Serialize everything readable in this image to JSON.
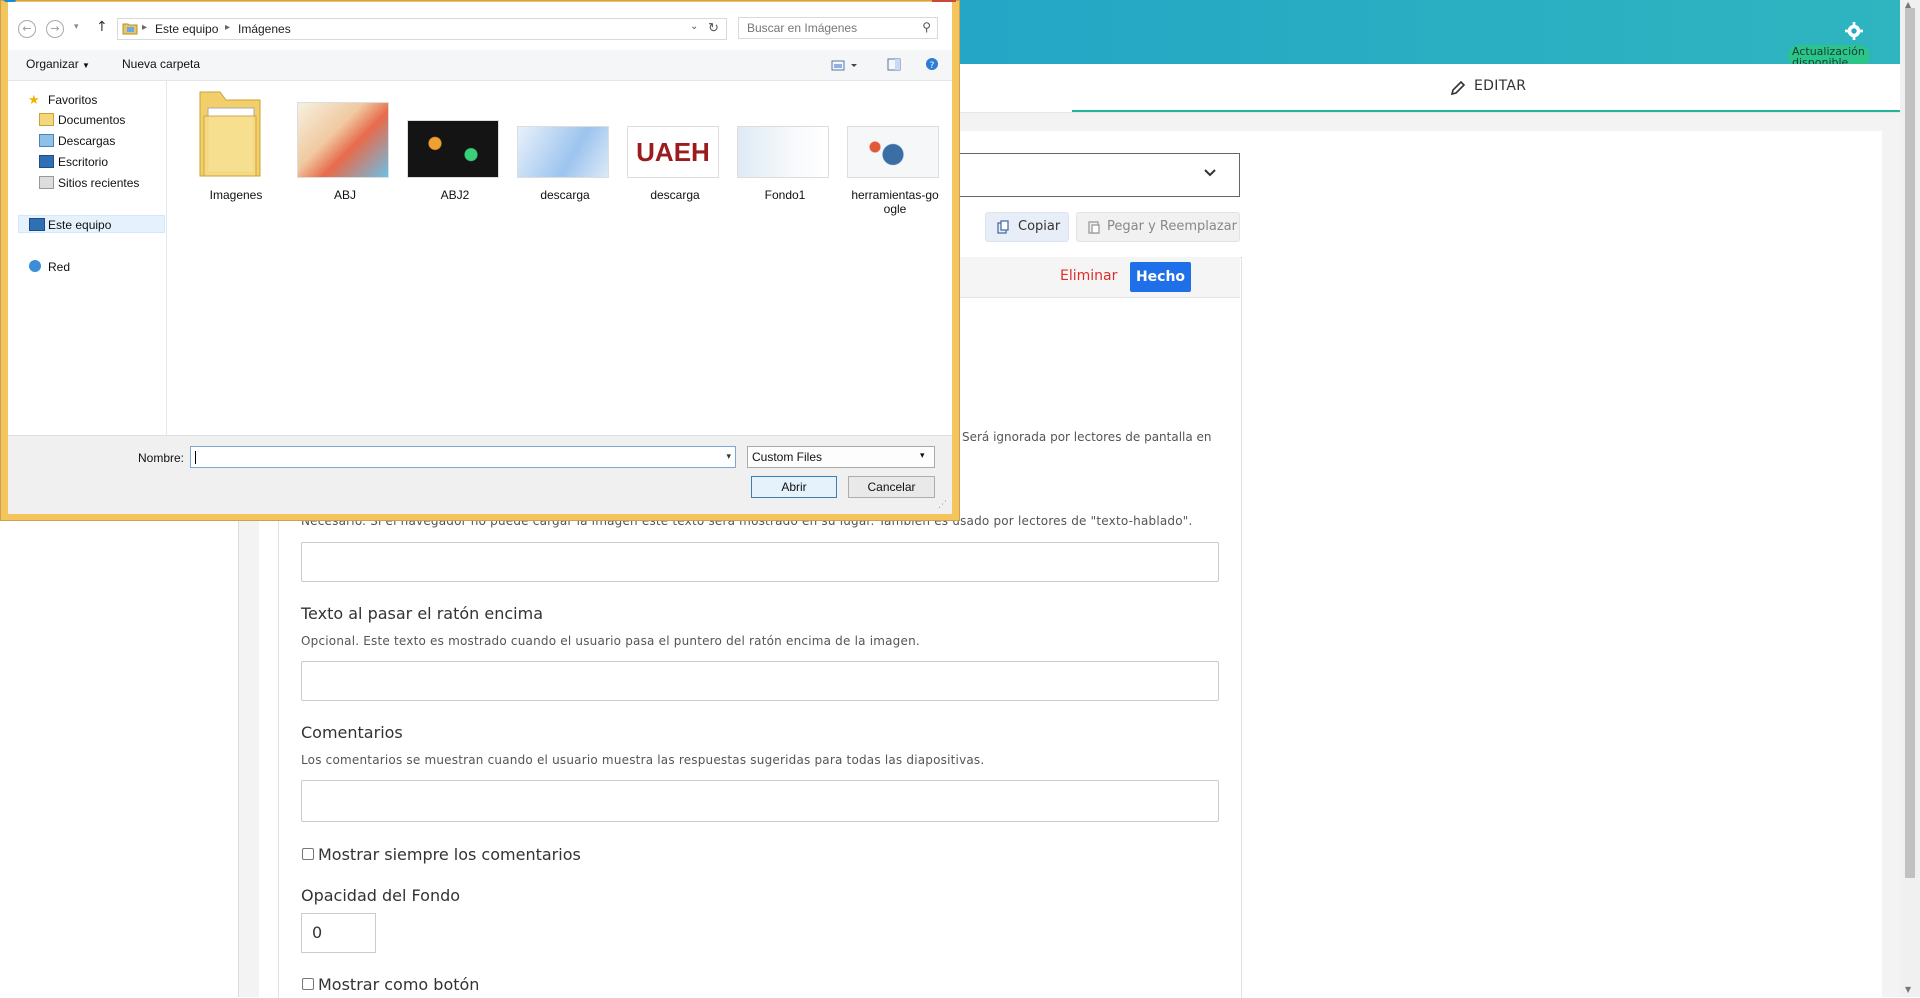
{
  "app": {
    "update_badge": "Actualización disponible",
    "tab_edit": "EDITAR"
  },
  "toolbar": {
    "copy": "Copiar",
    "paste_replace": "Pegar y Reemplazar",
    "delete": "Eliminar",
    "done": "Hecho"
  },
  "form": {
    "fragment_screen_reader": "Será ignorada por lectores de pantalla en",
    "alt_desc": "Necesario. Si el navegador no puede cargar la imagen este texto será mostrado en su lugar. También es usado por lectores de \"texto-hablado\".",
    "hover_label": "Texto al pasar el ratón encima",
    "hover_desc": "Opcional. Este texto es mostrado cuando el usuario pasa el puntero del ratón encima de la imagen.",
    "comments_label": "Comentarios",
    "comments_desc": "Los comentarios se muestran cuando el usuario muestra las respuestas sugeridas para todas las diapositivas.",
    "always_show_comments": "Mostrar siempre los comentarios",
    "bg_opacity_label": "Opacidad del Fondo",
    "bg_opacity_value": "0",
    "show_as_button": "Mostrar como botón"
  },
  "dialog": {
    "breadcrumb": [
      "Este equipo",
      "Imágenes"
    ],
    "search_placeholder": "Buscar en Imágenes",
    "organize": "Organizar",
    "new_folder": "Nueva carpeta",
    "nav": {
      "favorites": "Favoritos",
      "favorites_items": [
        "Documentos",
        "Descargas",
        "Escritorio",
        "Sitios recientes"
      ],
      "this_pc": "Este equipo",
      "network": "Red"
    },
    "files": [
      {
        "name": "Imagenes",
        "kind": "folder"
      },
      {
        "name": "ABJ",
        "kind": "image"
      },
      {
        "name": "ABJ2",
        "kind": "image"
      },
      {
        "name": "descarga",
        "kind": "image"
      },
      {
        "name": "descarga",
        "kind": "image",
        "logo_text": "UAEH"
      },
      {
        "name": "Fondo1",
        "kind": "image"
      },
      {
        "name": "herramientas-go\nogle",
        "kind": "image"
      }
    ],
    "filename_label": "Nombre:",
    "filename_value": "",
    "filter": "Custom Files",
    "open": "Abrir",
    "cancel": "Cancelar"
  },
  "colors": {
    "topbar": "#1e9bd0",
    "update_badge": "#2bc58a",
    "done_button": "#1f6fe8",
    "delete_text": "#e02c2c",
    "dialog_frame": "#f3c55c"
  }
}
